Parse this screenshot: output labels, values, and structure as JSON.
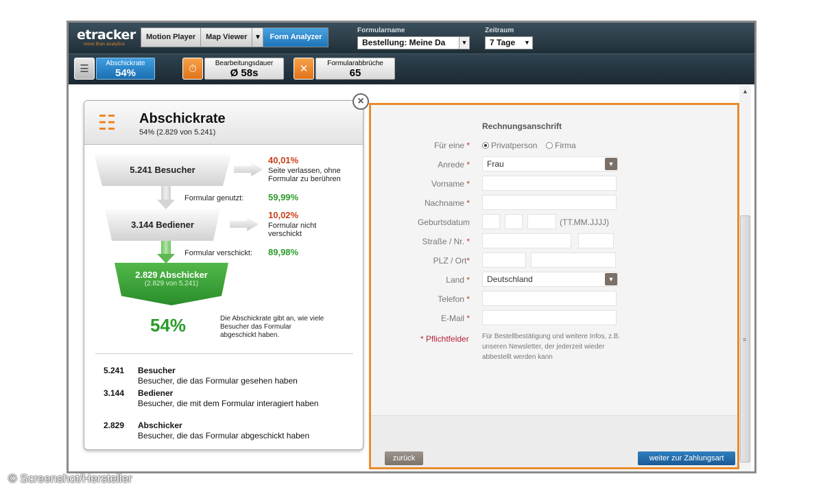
{
  "topbar": {
    "logo": "etracker",
    "logo_tagline": "more than analytics",
    "tabs": [
      "Motion Player",
      "Map Viewer",
      "Form Analyzer"
    ],
    "formname_label": "Formularname",
    "formname_value": "Bestellung: Meine Da",
    "zeitraum_label": "Zeitraum",
    "zeitraum_value": "7 Tage"
  },
  "kpis": [
    {
      "label": "Abschickrate",
      "value": "54%"
    },
    {
      "label": "Bearbeitungsdauer",
      "value": "Ø 58s"
    },
    {
      "label": "Formularabbrüche",
      "value": "65"
    }
  ],
  "left": {
    "title": "Abschickrate",
    "subtitle": "54% (2.829 von 5.241)",
    "funnel1": "5.241 Besucher",
    "funnel2": "3.144 Bediener",
    "funnel3": "2.829 Abschicker",
    "funnel3_sub": "(2.829 von 5.241)",
    "drop1_pct": "40,01%",
    "drop1_text1": "Seite verlassen, ohne",
    "drop1_text2": "Formular zu berühren",
    "used_label": "Formular genutzt:",
    "used_pct": "59,99%",
    "drop2_pct": "10,02%",
    "drop2_text1": "Formular nicht",
    "drop2_text2": "verschickt",
    "sent_label": "Formular verschickt:",
    "sent_pct": "89,98%",
    "big_pct": "54%",
    "note1": "Die Abschickrate gibt an, wie viele",
    "note2": "Besucher das Formular",
    "note3": "abgeschickt haben.",
    "stats": [
      {
        "num": "5.241",
        "name": "Besucher",
        "desc": "Besucher, die das Formular gesehen haben"
      },
      {
        "num": "3.144",
        "name": "Bediener",
        "desc": "Besucher, die mit dem Formular interagiert haben"
      },
      {
        "num": "2.829",
        "name": "Abschicker",
        "desc": "Besucher, die das Formular abgeschickt haben"
      }
    ]
  },
  "form": {
    "heading": "Rechnungsanschrift",
    "fuer_eine": "Für eine",
    "radio1": "Privatperson",
    "radio2": "Firma",
    "anrede": "Anrede",
    "anrede_value": "Frau",
    "vorname": "Vorname",
    "nachname": "Nachname",
    "geburtsdatum": "Geburtsdatum",
    "date_hint": "(TT.MM.JJJJ)",
    "strasse": "Straße / Nr.",
    "plz": "PLZ / Ort",
    "land": "Land",
    "land_value": "Deutschland",
    "telefon": "Telefon",
    "email": "E-Mail",
    "pflicht": "* Pflichtfelder",
    "pflicht_note": "Für Bestellbestätigung und weitere Infos, z.B. unseren Newsletter, der jederzeit wieder abbestellt werden kann",
    "back": "zurück",
    "next": "weiter zur Zahlungsart"
  },
  "credit": "© Screenshot/Hersteller"
}
